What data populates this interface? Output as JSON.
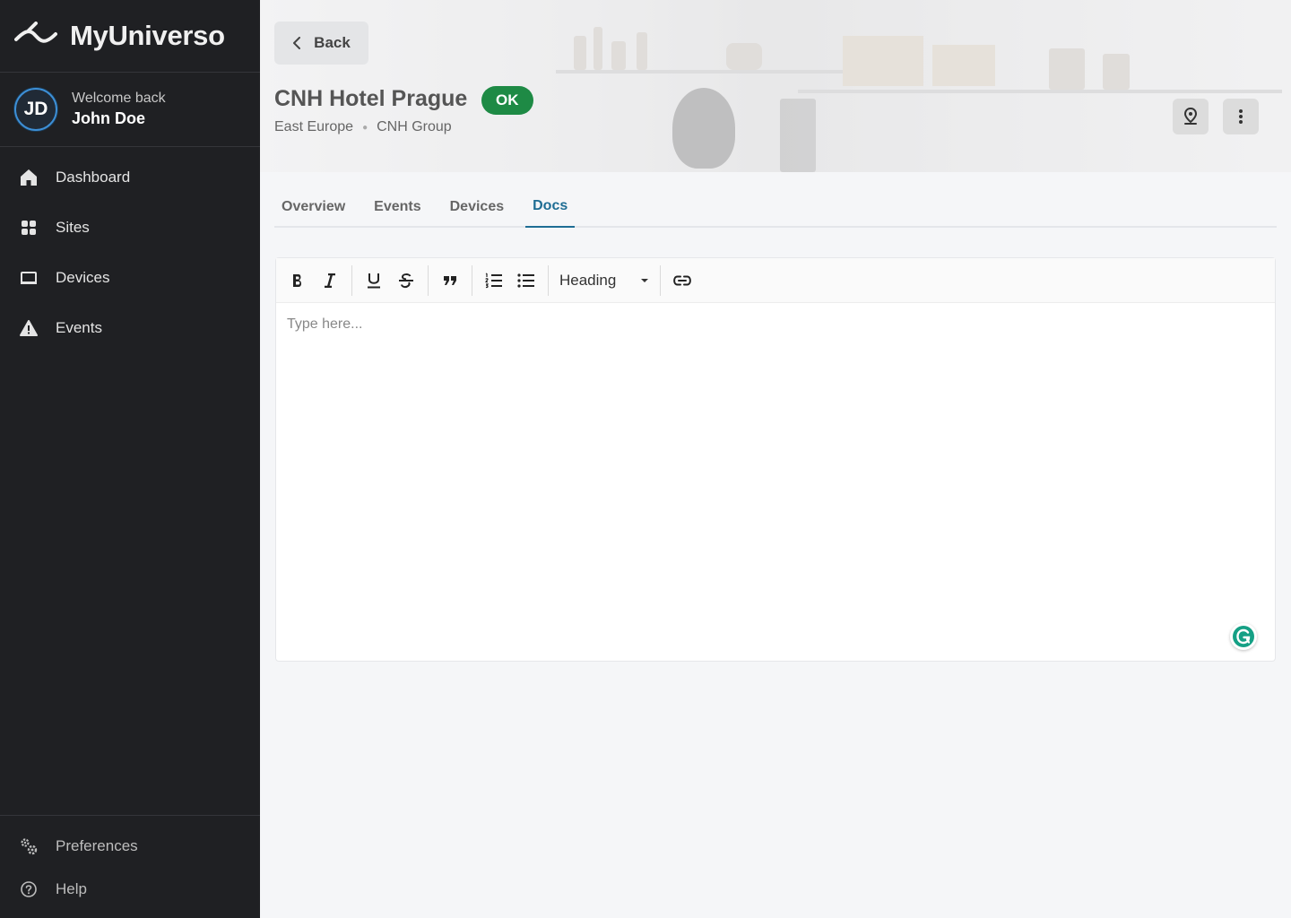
{
  "brand": {
    "name": "MyUniverso"
  },
  "user": {
    "initials": "JD",
    "welcome": "Welcome back",
    "name": "John Doe"
  },
  "nav": {
    "items": [
      {
        "label": "Dashboard",
        "icon": "home-icon"
      },
      {
        "label": "Sites",
        "icon": "grid-icon"
      },
      {
        "label": "Devices",
        "icon": "device-icon"
      },
      {
        "label": "Events",
        "icon": "warning-icon"
      }
    ],
    "bottom": [
      {
        "label": "Preferences",
        "icon": "gears-icon"
      },
      {
        "label": "Help",
        "icon": "help-icon"
      }
    ]
  },
  "header": {
    "back_label": "Back",
    "title": "CNH Hotel Prague",
    "status": "OK",
    "status_color": "#1e8a45",
    "region": "East Europe",
    "group": "CNH Group"
  },
  "tabs": [
    {
      "label": "Overview"
    },
    {
      "label": "Events"
    },
    {
      "label": "Devices"
    },
    {
      "label": "Docs",
      "active": true
    }
  ],
  "editor": {
    "heading_select": "Heading",
    "placeholder": "Type here..."
  },
  "colors": {
    "accent": "#1e6d94",
    "sidebar_bg": "#1f2023"
  }
}
